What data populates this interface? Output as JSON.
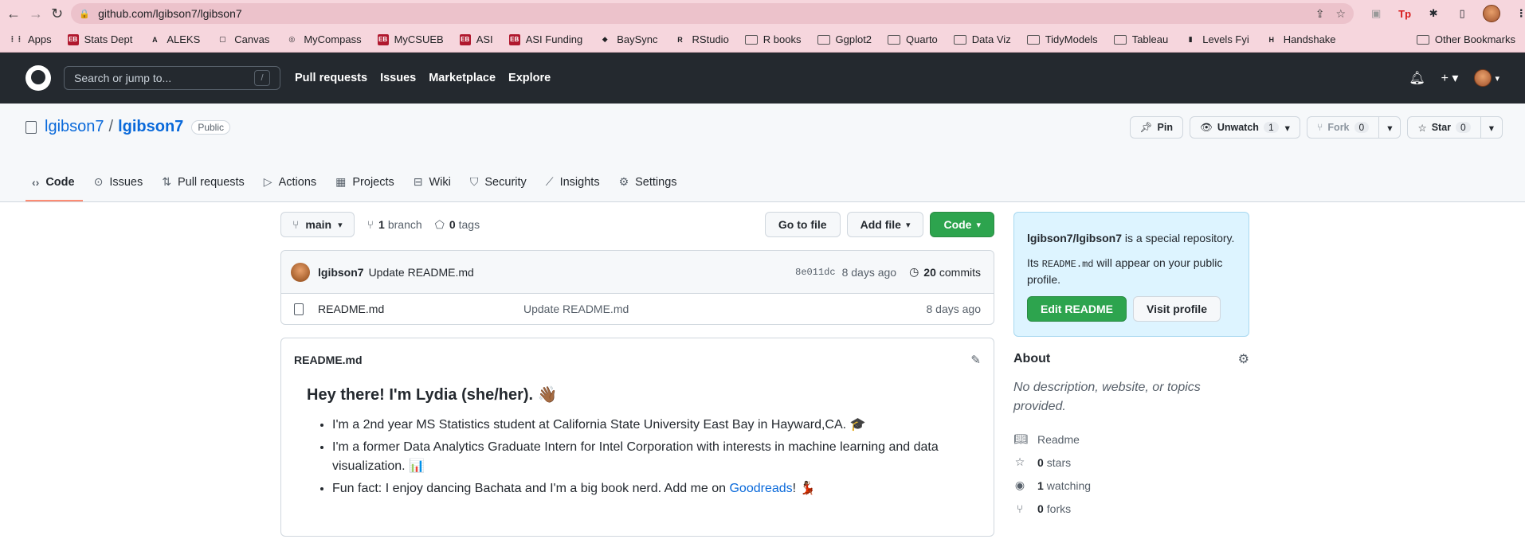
{
  "browser": {
    "url": "github.com/lgibson7/lgibson7",
    "bookmarks": [
      {
        "label": "Apps",
        "icon": "apps-grid-icon"
      },
      {
        "label": "Stats Dept",
        "icon": "eb-icon"
      },
      {
        "label": "ALEKS",
        "icon": "aleks-icon"
      },
      {
        "label": "Canvas",
        "icon": "canvas-icon"
      },
      {
        "label": "MyCompass",
        "icon": "compass-icon"
      },
      {
        "label": "MyCSUEB",
        "icon": "eb-icon"
      },
      {
        "label": "ASI",
        "icon": "eb-icon"
      },
      {
        "label": "ASI Funding",
        "icon": "eb-icon"
      },
      {
        "label": "BaySync",
        "icon": "baysync-icon"
      },
      {
        "label": "RStudio",
        "icon": "rstudio-icon"
      },
      {
        "label": "R books",
        "icon": "folder-icon"
      },
      {
        "label": "Ggplot2",
        "icon": "folder-icon"
      },
      {
        "label": "Quarto",
        "icon": "folder-icon"
      },
      {
        "label": "Data Viz",
        "icon": "folder-icon"
      },
      {
        "label": "TidyModels",
        "icon": "folder-icon"
      },
      {
        "label": "Tableau",
        "icon": "folder-icon"
      },
      {
        "label": "Levels Fyi",
        "icon": "levels-icon"
      },
      {
        "label": "Handshake",
        "icon": "handshake-icon"
      }
    ],
    "other_bookmarks": "Other Bookmarks"
  },
  "gh": {
    "search_placeholder": "Search or jump to...",
    "search_shortcut": "/",
    "nav": [
      "Pull requests",
      "Issues",
      "Marketplace",
      "Explore"
    ]
  },
  "repo": {
    "owner": "lgibson7",
    "separator": "/",
    "name": "lgibson7",
    "visibility": "Public",
    "pin": "Pin",
    "unwatch": "Unwatch",
    "watch_count": "1",
    "fork": "Fork",
    "fork_count": "0",
    "star": "Star",
    "star_count": "0",
    "tabs": [
      {
        "label": "Code",
        "icon": "code-icon",
        "active": true
      },
      {
        "label": "Issues",
        "icon": "issue-icon"
      },
      {
        "label": "Pull requests",
        "icon": "pull-request-icon"
      },
      {
        "label": "Actions",
        "icon": "play-icon"
      },
      {
        "label": "Projects",
        "icon": "table-icon"
      },
      {
        "label": "Wiki",
        "icon": "book-icon"
      },
      {
        "label": "Security",
        "icon": "shield-icon"
      },
      {
        "label": "Insights",
        "icon": "graph-icon"
      },
      {
        "label": "Settings",
        "icon": "gear-icon"
      }
    ]
  },
  "toolbar": {
    "branch": "main",
    "branch_count": "1",
    "branch_label": "branch",
    "tag_count": "0",
    "tag_label": "tags",
    "go_to_file": "Go to file",
    "add_file": "Add file",
    "code": "Code"
  },
  "commit": {
    "author": "lgibson7",
    "message": "Update README.md",
    "sha": "8e011dc",
    "age": "8 days ago",
    "count": "20",
    "count_label": "commits"
  },
  "files": [
    {
      "name": "README.md",
      "message": "Update README.md",
      "age": "8 days ago"
    }
  ],
  "readme": {
    "title": "README.md",
    "heading": "Hey there! I'm Lydia (she/her). 👋🏾",
    "bullets": [
      "I'm a 2nd year MS Statistics student at California State University East Bay in Hayward,CA. 🎓",
      "I'm a former Data Analytics Graduate Intern for Intel Corporation with interests in machine learning and data visualization. 📊"
    ],
    "fun_prefix": "Fun fact: I enjoy dancing Bachata and I'm a big book nerd. Add me on ",
    "fun_link": "Goodreads",
    "fun_suffix": "! 💃🏾"
  },
  "sidebar": {
    "special_repo": "lgibson7/lgibson7",
    "special_text": " is a special repository.",
    "its": "Its ",
    "readme_code": "README.md",
    "appear_text": " will appear on your public profile.",
    "edit_readme": "Edit README",
    "visit_profile": "Visit profile",
    "about": "About",
    "about_desc": "No description, website, or topics provided.",
    "readme_link": "Readme",
    "stars_count": "0",
    "stars_label": "stars",
    "watching_count": "1",
    "watching_label": "watching",
    "forks_count": "0",
    "forks_label": "forks"
  }
}
